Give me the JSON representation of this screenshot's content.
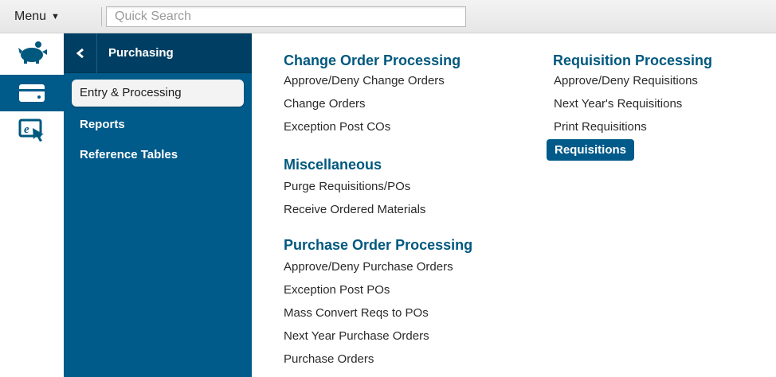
{
  "topbar": {
    "menu_label": "Menu",
    "search_placeholder": "Quick Search",
    "search_value": ""
  },
  "rail": {
    "items": [
      {
        "icon": "piggy-bank-icon"
      },
      {
        "icon": "credit-card-icon"
      },
      {
        "icon": "e-click-icon"
      }
    ]
  },
  "nav": {
    "title": "Purchasing",
    "items": [
      {
        "label": "Entry & Processing",
        "active": true
      },
      {
        "label": "Reports",
        "active": false
      },
      {
        "label": "Reference Tables",
        "active": false
      }
    ]
  },
  "sections": {
    "change_order": {
      "title": "Change Order Processing",
      "links": [
        "Approve/Deny Change Orders",
        "Change Orders",
        "Exception Post COs"
      ]
    },
    "miscellaneous": {
      "title": "Miscellaneous",
      "links": [
        "Purge Requisitions/POs",
        "Receive Ordered Materials"
      ]
    },
    "purchase_order": {
      "title": "Purchase Order Processing",
      "links": [
        "Approve/Deny Purchase Orders",
        "Exception Post POs",
        "Mass Convert Reqs to POs",
        "Next Year Purchase Orders",
        "Purchase Orders"
      ]
    },
    "requisition": {
      "title": "Requisition Processing",
      "links": [
        "Approve/Deny Requisitions",
        "Next Year's Requisitions",
        "Print Requisitions",
        "Requisitions"
      ],
      "selected": "Requisitions"
    }
  },
  "colors": {
    "nav_bg": "#005a8a",
    "nav_header_bg": "#003f63",
    "section_title": "#00587f"
  }
}
